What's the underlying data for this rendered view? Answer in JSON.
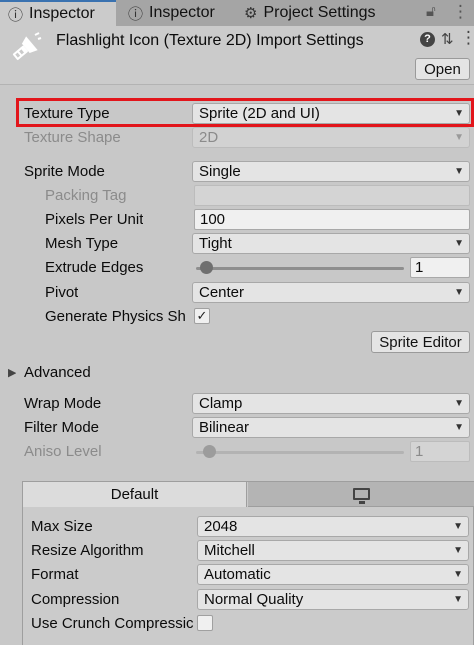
{
  "tabs": [
    {
      "label": "Inspector",
      "icon": "info-icon"
    },
    {
      "label": "Inspector",
      "icon": "info-icon"
    },
    {
      "label": "Project Settings",
      "icon": "gear-icon"
    }
  ],
  "header": {
    "title": "Flashlight Icon (Texture 2D) Import Settings",
    "open_label": "Open"
  },
  "fields": {
    "texture_type": {
      "label": "Texture Type",
      "value": "Sprite (2D and UI)"
    },
    "texture_shape": {
      "label": "Texture Shape",
      "value": "2D"
    },
    "sprite_mode": {
      "label": "Sprite Mode",
      "value": "Single"
    },
    "packing_tag": {
      "label": "Packing Tag",
      "value": ""
    },
    "pixels_per_unit": {
      "label": "Pixels Per Unit",
      "value": "100"
    },
    "mesh_type": {
      "label": "Mesh Type",
      "value": "Tight"
    },
    "extrude_edges": {
      "label": "Extrude Edges",
      "value": "1",
      "slider_fraction": 0.03
    },
    "pivot": {
      "label": "Pivot",
      "value": "Center"
    },
    "generate_physics": {
      "label": "Generate Physics Sh",
      "checked": true
    },
    "sprite_editor_label": "Sprite Editor",
    "advanced_label": "Advanced",
    "wrap_mode": {
      "label": "Wrap Mode",
      "value": "Clamp"
    },
    "filter_mode": {
      "label": "Filter Mode",
      "value": "Bilinear"
    },
    "aniso_level": {
      "label": "Aniso Level",
      "value": "1",
      "slider_fraction": 0.06
    }
  },
  "platform": {
    "default_tab": "Default",
    "other_tab_icon": "monitor-icon",
    "max_size": {
      "label": "Max Size",
      "value": "2048"
    },
    "resize_algorithm": {
      "label": "Resize Algorithm",
      "value": "Mitchell"
    },
    "format": {
      "label": "Format",
      "value": "Automatic"
    },
    "compression": {
      "label": "Compression",
      "value": "Normal Quality"
    },
    "use_crunch": {
      "label": "Use Crunch Compressic",
      "checked": false
    }
  },
  "colors": {
    "highlight": "#e2151b",
    "tab_accent": "#3a72b0"
  }
}
